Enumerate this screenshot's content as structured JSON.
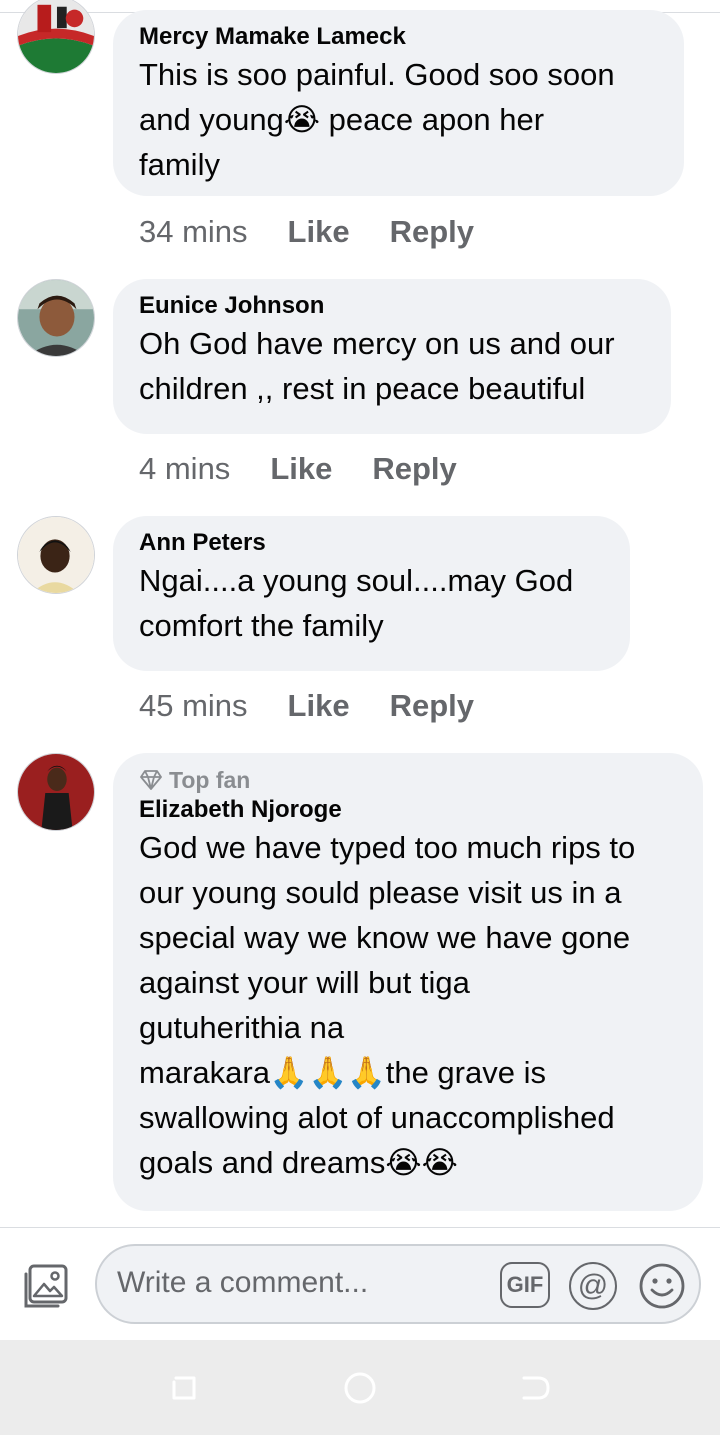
{
  "comments": [
    {
      "author": "Mercy Mamake Lameck",
      "text_lines": [
        "This is soo painful. Good soo soon",
        "and young😭 peace apon her",
        "family"
      ],
      "time": "34 mins",
      "like_label": "Like",
      "reply_label": "Reply"
    },
    {
      "author": "Eunice Johnson",
      "text_lines": [
        "Oh God have mercy on us and our",
        "children ,, rest in peace beautiful"
      ],
      "time": "4 mins",
      "like_label": "Like",
      "reply_label": "Reply"
    },
    {
      "author": "Ann Peters",
      "text_lines": [
        "Ngai....a young soul....may God",
        "comfort the family"
      ],
      "time": "45 mins",
      "like_label": "Like",
      "reply_label": "Reply"
    },
    {
      "badge": "Top fan",
      "author": "Elizabeth Njoroge",
      "text_lines": [
        "God we have typed too much rips to",
        "our young sould please visit us in a",
        "special way we know we have gone",
        "against your will but tiga",
        "gutuherithia na",
        "marakara🙏🙏🙏the grave is",
        "swallowing alot of unaccomplished",
        "goals and dreams😭😭"
      ]
    }
  ],
  "composer": {
    "placeholder": "Write a comment...",
    "gif_label": "GIF",
    "at_label": "@"
  },
  "icons": {
    "photo": "photo-icon",
    "smile": "smile-icon",
    "diamond": "diamond-icon",
    "nav_recents": "recents-icon",
    "nav_home": "home-icon",
    "nav_back": "back-icon"
  },
  "colors": {
    "bubble": "#f0f2f5",
    "meta_text": "#65676b",
    "badge_text": "#8a8d91",
    "navbar": "#ececec"
  }
}
